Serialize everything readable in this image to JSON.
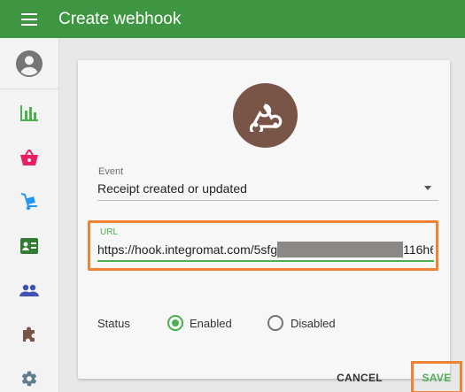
{
  "header": {
    "title": "Create webhook",
    "menu_icon": "hamburger-menu-icon"
  },
  "sidebar": {
    "avatar_icon": "account-circle-icon",
    "items": [
      {
        "icon": "bar-chart-icon",
        "color": "#4caf50"
      },
      {
        "icon": "shopping-basket-icon",
        "color": "#e91e63"
      },
      {
        "icon": "hand-truck-icon",
        "color": "#2196f3"
      },
      {
        "icon": "contact-card-icon",
        "color": "#2e7d32"
      },
      {
        "icon": "people-icon",
        "color": "#3f51b5"
      },
      {
        "icon": "puzzle-piece-icon",
        "color": "#795548"
      },
      {
        "icon": "gear-icon",
        "color": "#607d8b"
      }
    ]
  },
  "form": {
    "event_label": "Event",
    "event_value": "Receipt created or updated",
    "url_label": "URL",
    "url_prefix": "https://hook.integromat.com/5sfg",
    "url_suffix": "116h6",
    "status_label": "Status",
    "status_options": [
      "Enabled",
      "Disabled"
    ],
    "status_selected": "Enabled"
  },
  "actions": {
    "cancel_label": "CANCEL",
    "save_label": "SAVE"
  },
  "colors": {
    "primary": "#3f9642",
    "accent": "#4caf50",
    "highlight": "#ef8233",
    "webhook_bg": "#795548"
  }
}
